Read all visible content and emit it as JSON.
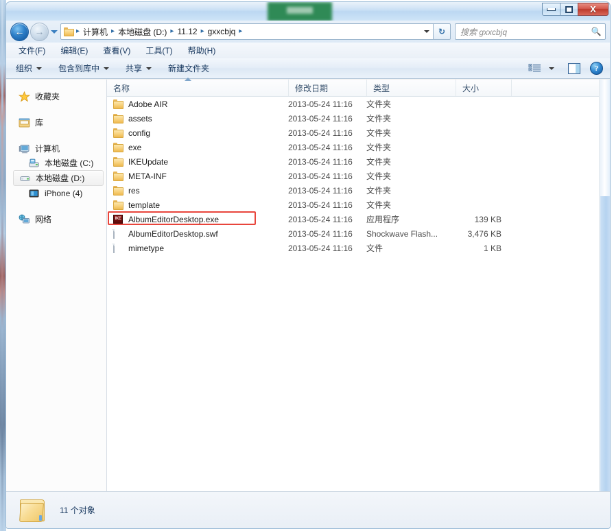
{
  "window": {
    "title_redacted": true,
    "buttons": {
      "minimize": "minimize",
      "maximize": "maximize",
      "close": "X"
    }
  },
  "addressbar": {
    "back_arrow": "←",
    "forward_arrow": "→",
    "folder_icon": "folder-icon",
    "crumbs": [
      "计算机",
      "本地磁盘 (D:)",
      "11.12",
      "gxxcbjq"
    ],
    "separator": "▸",
    "refresh_label": "↻",
    "search_placeholder": "搜索 gxxcbjq",
    "search_value": "",
    "search_icon": "🔍"
  },
  "menubar": {
    "items": [
      "文件(F)",
      "编辑(E)",
      "查看(V)",
      "工具(T)",
      "帮助(H)"
    ]
  },
  "toolbar": {
    "items": [
      {
        "label": "组织",
        "caret": true
      },
      {
        "label": "包含到库中",
        "caret": true
      },
      {
        "label": "共享",
        "caret": true
      },
      {
        "label": "新建文件夹",
        "caret": false
      }
    ],
    "right_icons": [
      "view-options-icon",
      "chevron-down-icon",
      "preview-pane-icon",
      "help-icon"
    ],
    "help_glyph": "?"
  },
  "sidebar": {
    "items": [
      {
        "label": "收藏夹",
        "icon": "star-icon",
        "level": 0,
        "selected": false
      },
      {
        "label": "库",
        "icon": "library-icon",
        "level": 0,
        "selected": false
      },
      {
        "label": "计算机",
        "icon": "computer-icon",
        "level": 0,
        "selected": false
      },
      {
        "label": "本地磁盘 (C:)",
        "icon": "system-drive-icon",
        "level": 1,
        "selected": false
      },
      {
        "label": "本地磁盘 (D:)",
        "icon": "drive-icon",
        "level": 1,
        "selected": true
      },
      {
        "label": "iPhone (4)",
        "icon": "iphone-icon",
        "level": 1,
        "selected": false
      },
      {
        "label": "网络",
        "icon": "network-icon",
        "level": 0,
        "selected": false
      }
    ]
  },
  "filelist": {
    "columns": [
      {
        "key": "name",
        "label": "名称",
        "sorted": "asc"
      },
      {
        "key": "date",
        "label": "修改日期",
        "sorted": null
      },
      {
        "key": "type",
        "label": "类型",
        "sorted": null
      },
      {
        "key": "size",
        "label": "大小",
        "sorted": null
      }
    ],
    "rows": [
      {
        "name": "Adobe AIR",
        "date": "2013-05-24 11:16",
        "type": "文件夹",
        "size": "",
        "icon": "folder-icon",
        "highlighted": false
      },
      {
        "name": "assets",
        "date": "2013-05-24 11:16",
        "type": "文件夹",
        "size": "",
        "icon": "folder-icon",
        "highlighted": false
      },
      {
        "name": "config",
        "date": "2013-05-24 11:16",
        "type": "文件夹",
        "size": "",
        "icon": "folder-icon",
        "highlighted": false
      },
      {
        "name": "exe",
        "date": "2013-05-24 11:16",
        "type": "文件夹",
        "size": "",
        "icon": "folder-icon",
        "highlighted": false
      },
      {
        "name": "IKEUpdate",
        "date": "2013-05-24 11:16",
        "type": "文件夹",
        "size": "",
        "icon": "folder-icon",
        "highlighted": false
      },
      {
        "name": "META-INF",
        "date": "2013-05-24 11:16",
        "type": "文件夹",
        "size": "",
        "icon": "folder-icon",
        "highlighted": false
      },
      {
        "name": "res",
        "date": "2013-05-24 11:16",
        "type": "文件夹",
        "size": "",
        "icon": "folder-icon",
        "highlighted": false
      },
      {
        "name": "template",
        "date": "2013-05-24 11:16",
        "type": "文件夹",
        "size": "",
        "icon": "folder-icon",
        "highlighted": false
      },
      {
        "name": "AlbumEditorDesktop.exe",
        "date": "2013-05-24 11:16",
        "type": "应用程序",
        "size": "139 KB",
        "icon": "exe-icon",
        "icon_text": "IKE",
        "highlighted": true
      },
      {
        "name": "AlbumEditorDesktop.swf",
        "date": "2013-05-24 11:16",
        "type": "Shockwave Flash...",
        "size": "3,476 KB",
        "icon": "file-icon",
        "highlighted": false
      },
      {
        "name": "mimetype",
        "date": "2013-05-24 11:16",
        "type": "文件",
        "size": "1 KB",
        "icon": "file-icon",
        "highlighted": false
      }
    ]
  },
  "statusbar": {
    "icon": "folder-large-icon",
    "text": "11 个对象"
  },
  "colors": {
    "highlight_border": "#e8453c",
    "redaction": "#2f8a56",
    "accent_blue": "#2d6ca6",
    "title_glass": "#c3dcf3"
  }
}
